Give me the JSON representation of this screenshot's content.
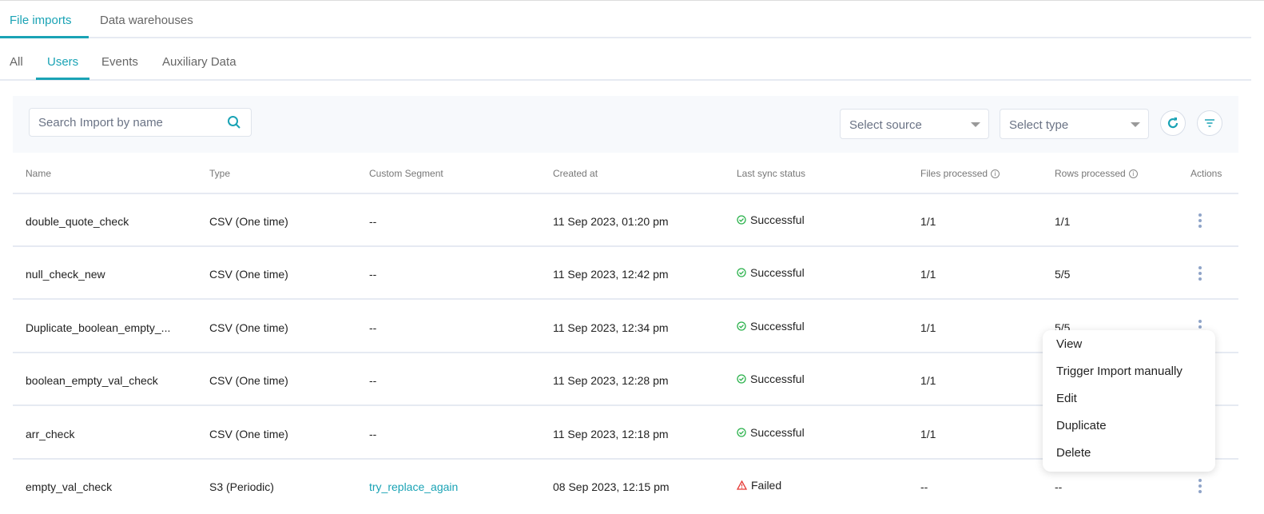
{
  "top_tabs": [
    "File imports",
    "Data warehouses"
  ],
  "sub_tabs": [
    "All",
    "Users",
    "Events",
    "Auxiliary Data"
  ],
  "toolbar": {
    "search_placeholder": "Search Import by name",
    "source_placeholder": "Select source",
    "type_placeholder": "Select type"
  },
  "columns": [
    "Name",
    "Type",
    "Custom Segment",
    "Created at",
    "Last sync status",
    "Files processed",
    "Rows processed",
    "Actions"
  ],
  "rows": [
    {
      "name": "double_quote_check",
      "type": "CSV (One time)",
      "segment": "--",
      "created": "11 Sep 2023, 01:20 pm",
      "status": "Successful",
      "files": "1/1",
      "rows": "1/1"
    },
    {
      "name": "null_check_new",
      "type": "CSV (One time)",
      "segment": "--",
      "created": "11 Sep 2023, 12:42 pm",
      "status": "Successful",
      "files": "1/1",
      "rows": "5/5"
    },
    {
      "name": "Duplicate_boolean_empty_...",
      "type": "CSV (One time)",
      "segment": "--",
      "created": "11 Sep 2023, 12:34 pm",
      "status": "Successful",
      "files": "1/1",
      "rows": "5/5"
    },
    {
      "name": "boolean_empty_val_check",
      "type": "CSV (One time)",
      "segment": "--",
      "created": "11 Sep 2023, 12:28 pm",
      "status": "Successful",
      "files": "1/1",
      "rows": ""
    },
    {
      "name": "arr_check",
      "type": "CSV (One time)",
      "segment": "--",
      "created": "11 Sep 2023, 12:18 pm",
      "status": "Successful",
      "files": "1/1",
      "rows": ""
    },
    {
      "name": "empty_val_check",
      "type": "S3 (Periodic)",
      "segment": "try_replace_again",
      "created": "08 Sep 2023, 12:15 pm",
      "status": "Failed",
      "files": "--",
      "rows": "--"
    }
  ],
  "menu": [
    "View",
    "Trigger Import manually",
    "Edit",
    "Duplicate",
    "Delete"
  ],
  "colors": {
    "accent": "#1aa3b5",
    "success": "#2bb24c",
    "failed": "#e53935"
  }
}
